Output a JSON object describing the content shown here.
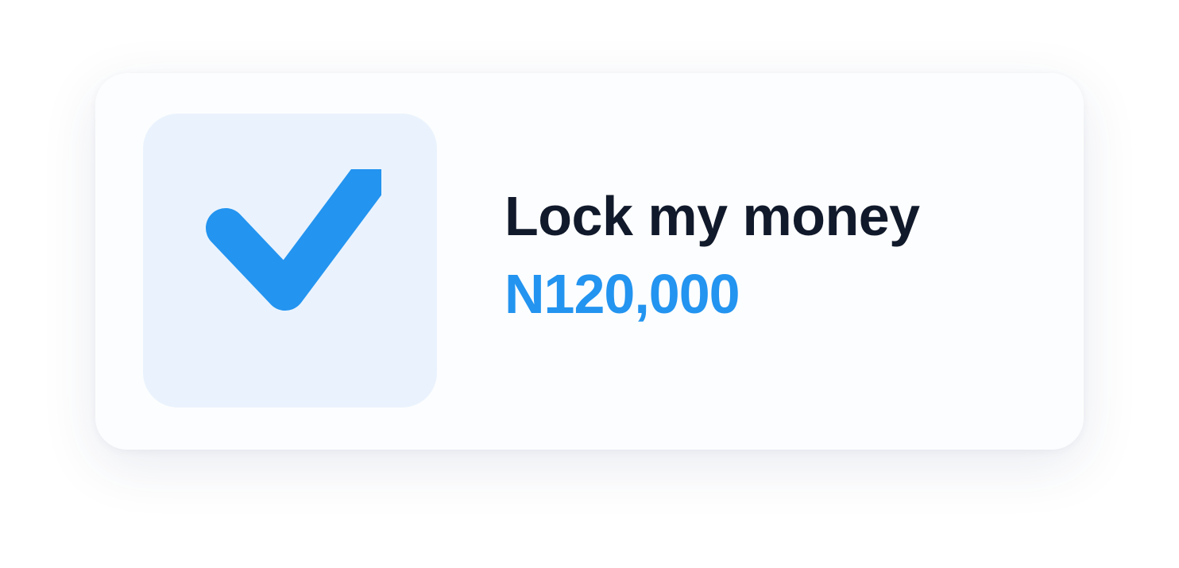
{
  "card": {
    "title": "Lock my money",
    "amount": "N120,000",
    "checked": true,
    "icon": "check-icon"
  },
  "colors": {
    "accent": "#2394f0",
    "title": "#111a2b",
    "icon_tile_background": "#eaf3fd",
    "card_background": "#fcfdfe"
  }
}
